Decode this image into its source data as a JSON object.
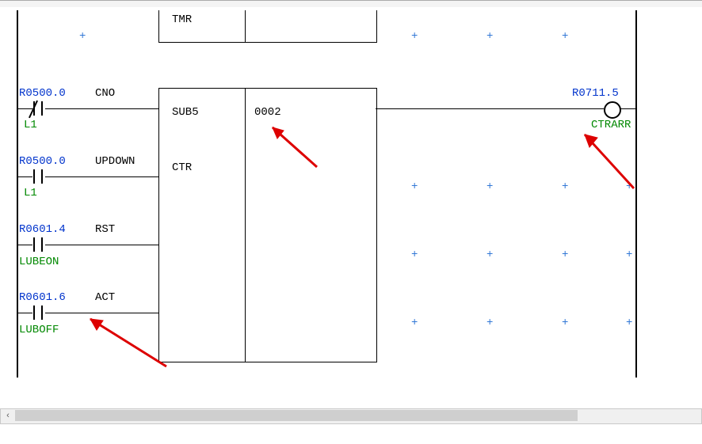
{
  "blocks": {
    "tmr": {
      "label_left": "TMR"
    },
    "sub5": {
      "label_left": "SUB5",
      "label_right": "0002",
      "label_below": "CTR"
    }
  },
  "rows": {
    "cno": {
      "addr": "R0500.0",
      "label": "CNO",
      "comment": "L1"
    },
    "updown": {
      "addr": "R0500.0",
      "label": "UPDOWN",
      "comment": "L1"
    },
    "rst": {
      "addr": "R0601.4",
      "label": "RST",
      "comment": "LUBEON"
    },
    "act": {
      "addr": "R0601.6",
      "label": "ACT",
      "comment": "LUBOFF"
    }
  },
  "coil": {
    "addr": "R0711.5",
    "comment": "CTRARR"
  },
  "scroll": {
    "glyph_left": "‹",
    "thumb_pct": 82
  }
}
